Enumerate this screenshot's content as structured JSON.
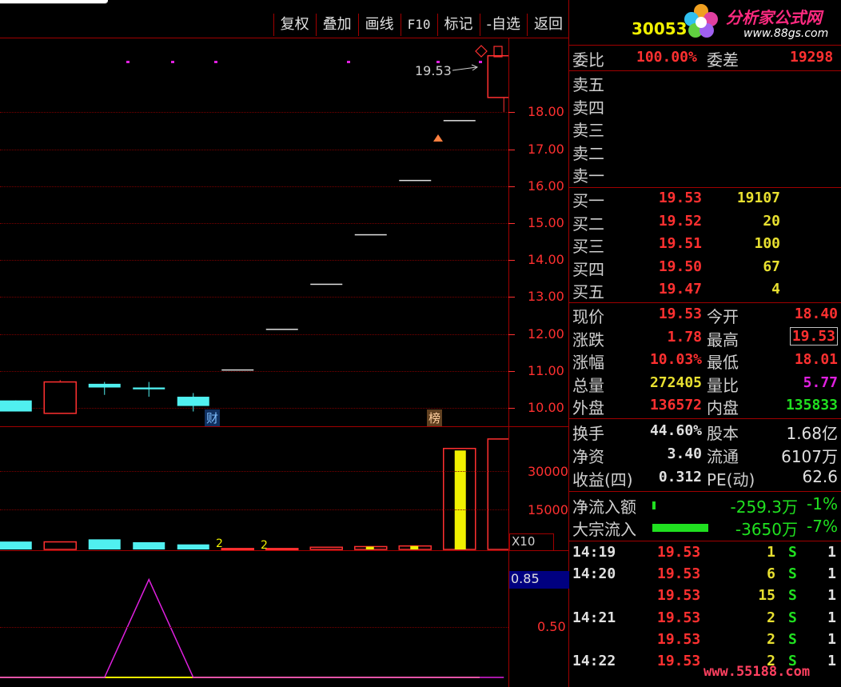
{
  "toolbar": {
    "buttons": [
      "复权",
      "叠加",
      "画线",
      "F10",
      "标记",
      "-自选",
      "返回"
    ]
  },
  "chart": {
    "price_axis": [
      "18.00",
      "17.00",
      "16.00",
      "15.00",
      "14.00",
      "13.00",
      "12.00",
      "11.00",
      "10.00"
    ],
    "last_price_label": "19.53",
    "badge_cai": "财",
    "badge_bang": "榜",
    "volume_axis": [
      "30000",
      "15000"
    ],
    "volume_unit": "X10",
    "volume_markers": [
      "2",
      "2"
    ],
    "indicator_axis": [
      "0.85",
      "0.50"
    ]
  },
  "chart_data": {
    "type": "candlestick",
    "price_ylim": [
      9.5,
      20.0
    ],
    "candles": [
      {
        "o": 9.9,
        "c": 10.2,
        "h": 10.2,
        "l": 9.9,
        "color": "cyan"
      },
      {
        "o": 9.85,
        "c": 10.7,
        "h": 10.75,
        "l": 9.85,
        "color": "red"
      },
      {
        "o": 10.55,
        "c": 10.65,
        "h": 10.7,
        "l": 10.35,
        "color": "cyan"
      },
      {
        "o": 10.5,
        "c": 10.55,
        "h": 10.7,
        "l": 10.3,
        "color": "cyan"
      },
      {
        "o": 10.05,
        "c": 10.3,
        "h": 10.4,
        "l": 9.9,
        "color": "cyan"
      },
      {
        "o": 11.04,
        "c": 11.04,
        "h": 11.04,
        "l": 11.04,
        "color": "white"
      },
      {
        "o": 12.14,
        "c": 12.14,
        "h": 12.14,
        "l": 12.14,
        "color": "white"
      },
      {
        "o": 13.36,
        "c": 13.36,
        "h": 13.36,
        "l": 13.36,
        "color": "white"
      },
      {
        "o": 14.7,
        "c": 14.7,
        "h": 14.7,
        "l": 14.7,
        "color": "white"
      },
      {
        "o": 16.17,
        "c": 16.17,
        "h": 16.17,
        "l": 16.17,
        "color": "white"
      },
      {
        "o": 17.79,
        "c": 17.79,
        "h": 17.79,
        "l": 17.79,
        "color": "white"
      },
      {
        "o": 18.4,
        "c": 19.53,
        "h": 19.53,
        "l": 18.01,
        "color": "red"
      }
    ],
    "volumes": [
      2500,
      2400,
      3200,
      2300,
      1600,
      300,
      300,
      700,
      900,
      1100,
      32000,
      35000
    ],
    "volume_ylim": [
      0,
      37000
    ],
    "indicator": [
      0,
      0,
      0,
      0.85,
      0,
      0,
      0,
      0,
      0,
      0,
      0,
      0
    ],
    "indicator_ylim": [
      0,
      1.0
    ]
  },
  "panel": {
    "code": "30053",
    "brand": "分析家公式网",
    "brand_url": "www.88gs.com",
    "weibi_label": "委比",
    "weibi_value": "100.00%",
    "weicha_label": "委差",
    "weicha_value": "19298",
    "sells": [
      "卖五",
      "卖四",
      "卖三",
      "卖二",
      "卖一"
    ],
    "buys": [
      {
        "label": "买一",
        "price": "19.53",
        "vol": "19107"
      },
      {
        "label": "买二",
        "price": "19.52",
        "vol": "20"
      },
      {
        "label": "买三",
        "price": "19.51",
        "vol": "100"
      },
      {
        "label": "买四",
        "price": "19.50",
        "vol": "67"
      },
      {
        "label": "买五",
        "price": "19.47",
        "vol": "4"
      }
    ],
    "quote": [
      {
        "l1": "现价",
        "v1": "19.53",
        "l2": "今开",
        "v2": "18.40"
      },
      {
        "l1": "涨跌",
        "v1": "1.78",
        "l2": "最高",
        "v2": "19.53"
      },
      {
        "l1": "涨幅",
        "v1": "10.03%",
        "l2": "最低",
        "v2": "18.01"
      },
      {
        "l1": "总量",
        "v1": "272405",
        "l2": "量比",
        "v2": "5.77"
      },
      {
        "l1": "外盘",
        "v1": "136572",
        "l2": "内盘",
        "v2": "135833"
      }
    ],
    "fund": [
      {
        "l1": "换手",
        "v1": "44.60%",
        "l2": "股本",
        "v2": "1.68亿"
      },
      {
        "l1": "净资",
        "v1": "3.40",
        "l2": "流通",
        "v2": "6107万"
      },
      {
        "l1": "收益(四)",
        "v1": "0.312",
        "l2": "PE(动)",
        "v2": "62.6"
      }
    ],
    "flow": [
      {
        "label": "净流入额",
        "value": "-259.3万",
        "pct": "-1%"
      },
      {
        "label": "大宗流入",
        "value": "-3650万",
        "pct": "-7%"
      }
    ],
    "ticks": [
      {
        "time": "14:19",
        "price": "19.53",
        "vol": "1",
        "side": "S",
        "n": "1"
      },
      {
        "time": "14:20",
        "price": "19.53",
        "vol": "6",
        "side": "S",
        "n": "1"
      },
      {
        "time": "",
        "price": "19.53",
        "vol": "15",
        "side": "S",
        "n": "1"
      },
      {
        "time": "14:21",
        "price": "19.53",
        "vol": "2",
        "side": "S",
        "n": "1"
      },
      {
        "time": "",
        "price": "19.53",
        "vol": "2",
        "side": "S",
        "n": "1"
      },
      {
        "time": "14:22",
        "price": "19.53",
        "vol": "2",
        "side": "S",
        "n": "1"
      }
    ],
    "watermark": "www.55188.com"
  },
  "colors": {
    "red": "#ff3030",
    "cyan": "#50f0f0",
    "yellow": "#f0f000",
    "green": "#20e020",
    "magenta": "#e020e0",
    "frame": "#a00000"
  }
}
